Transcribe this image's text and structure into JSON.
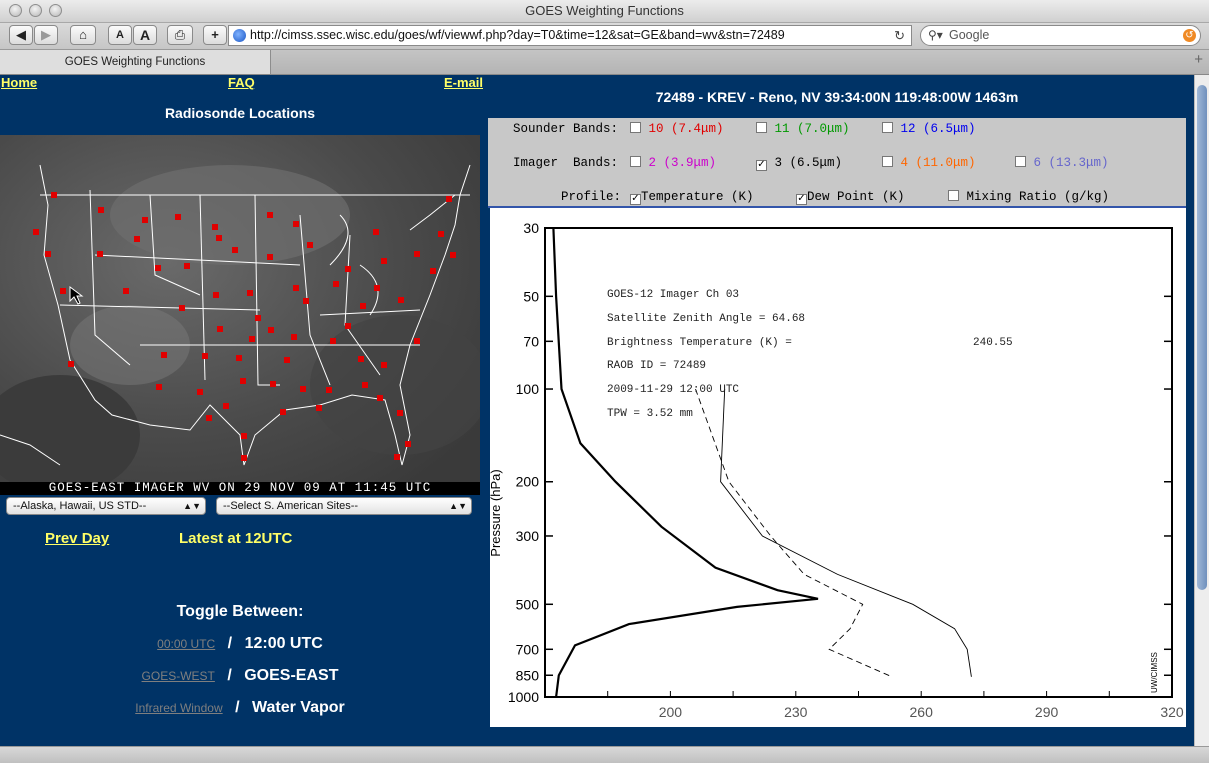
{
  "window": {
    "title": "GOES Weighting Functions"
  },
  "toolbar": {
    "url": "http://cimss.ssec.wisc.edu/goes/wf/viewwf.php?day=T0&time=12&sat=GE&band=wv&stn=72489",
    "search_placeholder": "Google",
    "font_small": "A",
    "font_large": "A",
    "add_label": "+"
  },
  "tab": {
    "label": "GOES Weighting Functions"
  },
  "nav": {
    "home": "Home",
    "faq": "FAQ",
    "email": "E-mail"
  },
  "left": {
    "heading": "Radiosonde Locations",
    "map_caption": "GOES-EAST IMAGER WV ON 29 NOV 09 AT 11:45 UTC",
    "select_alaska": "--Alaska, Hawaii, US STD--",
    "select_sam": "--Select S. American Sites--",
    "prev_day": "Prev Day",
    "latest": "Latest at 12UTC",
    "toggle_heading": "Toggle Between:",
    "time_other": "00:00 UTC",
    "time_current": "12:00 UTC",
    "sat_other": "GOES-WEST",
    "sat_current": "GOES-EAST",
    "band_other": "Infrared Window",
    "band_current": "Water Vapor",
    "slash": "/"
  },
  "station_title": "72489 - KREV - Reno, NV 39:34:00N 119:48:00W 1463m",
  "controls": {
    "sounder_label": "Sounder Bands:",
    "sounder_bands": [
      {
        "label": "10 (7.4μm)",
        "color": "#e00000",
        "checked": false
      },
      {
        "label": "11 (7.0μm)",
        "color": "#009900",
        "checked": false
      },
      {
        "label": "12 (6.5μm)",
        "color": "#0000ee",
        "checked": false
      }
    ],
    "imager_label": "Imager  Bands:",
    "imager_bands": [
      {
        "label": "2 (3.9μm)",
        "color": "#cc00cc",
        "checked": false
      },
      {
        "label": "3 (6.5μm)",
        "color": "#000000",
        "checked": true
      },
      {
        "label": "4 (11.0μm)",
        "color": "#ff6600",
        "checked": false
      },
      {
        "label": "6 (13.3μm)",
        "color": "#6666cc",
        "checked": false
      }
    ],
    "profile_label": "Profile:",
    "profiles": [
      {
        "label": "Temperature (K)",
        "checked": true
      },
      {
        "label": "Dew Point (K)",
        "checked": true
      },
      {
        "label": "Mixing Ratio (g/kg)",
        "checked": false
      }
    ]
  },
  "chart_data": {
    "type": "line",
    "ylabel": "Pressure (hPa)",
    "y_scale": "log-reversed",
    "ylim": [
      1000,
      30
    ],
    "y_ticks": [
      30,
      50,
      70,
      100,
      200,
      300,
      500,
      700,
      850,
      1000
    ],
    "x_ticks": [
      200,
      230,
      260,
      290,
      320
    ],
    "annotations": [
      "GOES-12 Imager  Ch     03",
      "Satellite Zenith Angle = 64.68",
      "Brightness Temperature (K) =",
      "RAOB ID = 72489",
      "2009-11-29 12:00 UTC",
      "TPW = 3.52 mm"
    ],
    "brightness_temperature": "240.55",
    "credit": "UW/CIMSS",
    "series": [
      {
        "style": "thick-solid",
        "points": [
          [
            0.02,
            30
          ],
          [
            0.03,
            50
          ],
          [
            0.05,
            100
          ],
          [
            0.12,
            150
          ],
          [
            0.25,
            200
          ],
          [
            0.42,
            280
          ],
          [
            0.62,
            380
          ],
          [
            0.85,
            450
          ],
          [
            1.0,
            480
          ],
          [
            0.7,
            510
          ],
          [
            0.3,
            580
          ],
          [
            0.1,
            680
          ],
          [
            0.04,
            850
          ],
          [
            0.03,
            1000
          ]
        ]
      },
      {
        "style": "thin-solid",
        "x_units": "K",
        "points": [
          [
            213,
            100
          ],
          [
            212,
            200
          ],
          [
            222,
            300
          ],
          [
            240,
            400
          ],
          [
            258,
            500
          ],
          [
            268,
            600
          ],
          [
            271,
            700
          ],
          [
            272,
            860
          ]
        ]
      },
      {
        "style": "dashed",
        "x_units": "K",
        "points": [
          [
            206,
            100
          ],
          [
            214,
            200
          ],
          [
            224,
            300
          ],
          [
            232,
            400
          ],
          [
            246,
            500
          ],
          [
            243,
            600
          ],
          [
            238,
            700
          ],
          [
            253,
            860
          ]
        ]
      }
    ]
  }
}
